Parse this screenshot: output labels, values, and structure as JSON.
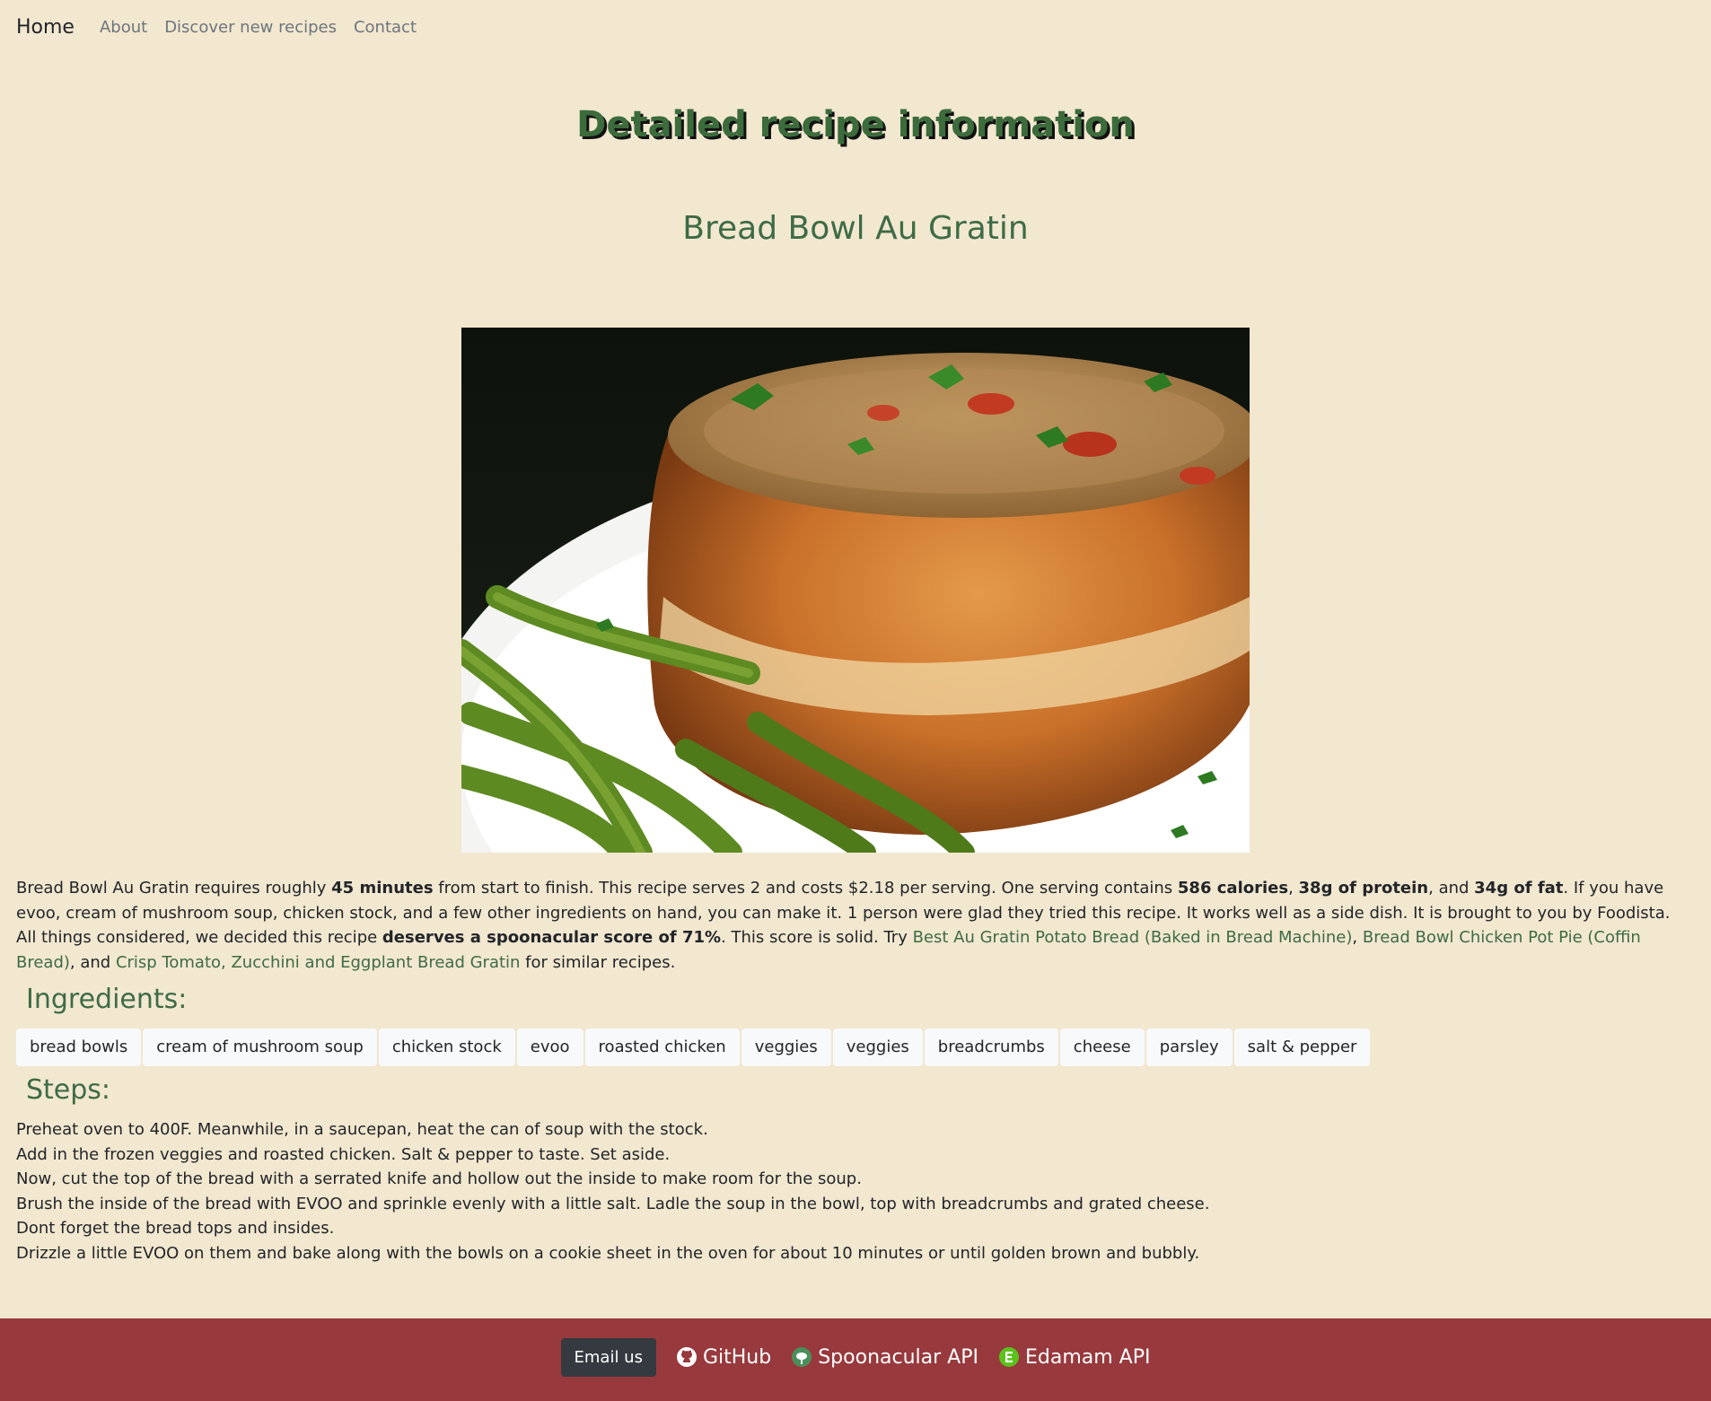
{
  "nav": {
    "brand": "Home",
    "links": [
      "About",
      "Discover new recipes",
      "Contact"
    ]
  },
  "page_title": "Detailed recipe information",
  "recipe": {
    "title": "Bread Bowl Au Gratin",
    "summary": {
      "s1": "Bread Bowl Au Gratin requires roughly ",
      "b_time": "45 minutes",
      "s2": " from start to finish. This recipe serves 2 and costs $2.18 per serving. One serving contains ",
      "b_cal": "586 calories",
      "s3": ", ",
      "b_protein": "38g of protein",
      "s4": ", and ",
      "b_fat": "34g of fat",
      "s5": ". If you have evoo, cream of mushroom soup, chicken stock, and a few other ingredients on hand, you can make it. 1 person were glad they tried this recipe. It works well as a side dish. It is brought to you by Foodista. All things considered, we decided this recipe ",
      "b_score": "deserves a spoonacular score of 71%",
      "s6": ". This score is solid. Try ",
      "link1": "Best Au Gratin Potato Bread (Baked in Bread Machine)",
      "s7": ", ",
      "link2": "Bread Bowl Chicken Pot Pie (Coffin Bread)",
      "s8": ", and ",
      "link3": "Crisp Tomato, Zucchini and Eggplant Bread Gratin",
      "s9": " for similar recipes."
    },
    "ingredients_heading": "Ingredients:",
    "ingredients": [
      "bread bowls",
      "cream of mushroom soup",
      "chicken stock",
      "evoo",
      "roasted chicken",
      "veggies",
      "veggies",
      "breadcrumbs",
      "cheese",
      "parsley",
      "salt & pepper"
    ],
    "steps_heading": "Steps:",
    "steps": [
      "Preheat oven to 400F. Meanwhile, in a saucepan, heat the can of soup with the stock.",
      "Add in the frozen veggies and roasted chicken. Salt & pepper to taste. Set aside.",
      "Now, cut the top of the bread with a serrated knife and hollow out the inside to make room for the soup.",
      "Brush the inside of the bread with EVOO and sprinkle evenly with a little salt. Ladle the soup in the bowl, top with breadcrumbs and grated cheese.",
      "Dont forget the bread tops and insides.",
      "Drizzle a little EVOO on them and bake along with the bowls on a cookie sheet in the oven for about 10 minutes or until golden brown and bubbly."
    ]
  },
  "footer": {
    "email_label": "Email us",
    "links": [
      {
        "label": "GitHub",
        "icon": "github-icon"
      },
      {
        "label": "Spoonacular API",
        "icon": "spoonacular-icon"
      },
      {
        "label": "Edamam API",
        "icon": "edamam-icon"
      }
    ]
  },
  "colors": {
    "background": "#f2e7cf",
    "accent_green": "#3d6b45",
    "footer": "#98393d",
    "email_button": "#343a40"
  }
}
